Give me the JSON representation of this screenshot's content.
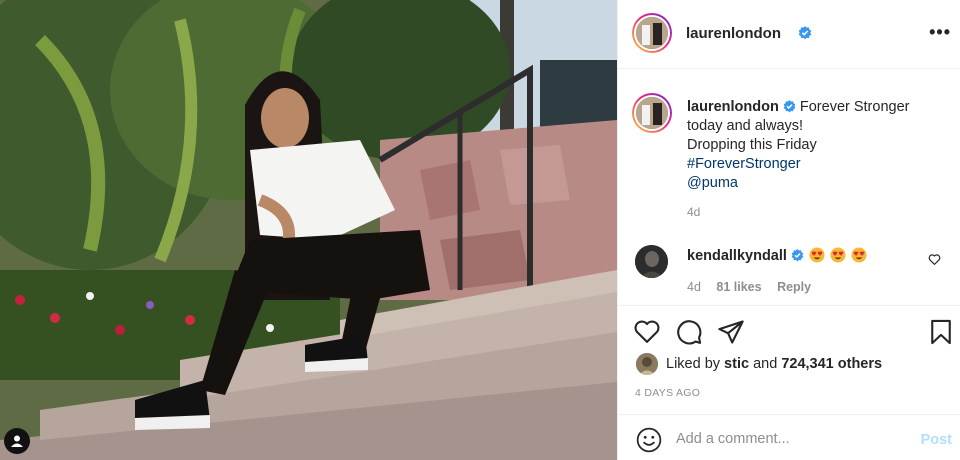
{
  "post": {
    "author": "laurenlondon",
    "verified_icon": "verified-badge-icon",
    "more_icon": "more-options-icon"
  },
  "caption": {
    "author": "laurenlondon",
    "text_line1": "Forever Stronger",
    "text_line2": "today and always!",
    "text_line3": "Dropping this Friday",
    "hashtag": "#ForeverStronger",
    "mention": "@puma",
    "time": "4d"
  },
  "comment": {
    "author": "kendallkyndall",
    "emojis": [
      "heart-eyes-emoji",
      "heart-eyes-emoji",
      "heart-eyes-emoji"
    ],
    "time": "4d",
    "likes": "81 likes",
    "reply": "Reply"
  },
  "actions": {
    "icons": [
      "like-heart-icon",
      "comment-bubble-icon",
      "share-plane-icon",
      "save-bookmark-icon"
    ]
  },
  "likes": {
    "prefix": "Liked by",
    "user": "stic",
    "middle": "and",
    "count": "724,341 others"
  },
  "date": "4 DAYS AGO",
  "add_comment": {
    "placeholder": "Add a comment...",
    "post_label": "Post"
  },
  "colors": {
    "link": "#00376b",
    "verified": "#3897f0",
    "post_disabled": "#b2dffc",
    "muted": "#8e8e8e"
  }
}
